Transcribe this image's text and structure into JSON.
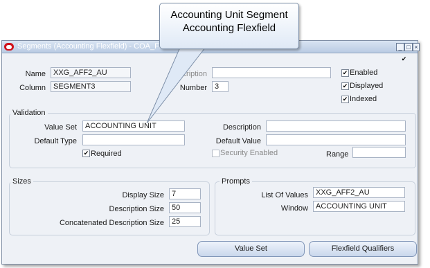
{
  "callout": {
    "line1": "Accounting Unit Segment",
    "line2": "Accounting Flexfield"
  },
  "window": {
    "title": "Segments (Accounting Flexfield) - COA_FLEXFIELD",
    "minimize": "_",
    "maximize": "□",
    "close": "×"
  },
  "top_checkmark": "✔",
  "segment": {
    "name_label": "Name",
    "name_value": "XXG_AFF2_AU",
    "column_label": "Column",
    "column_value": "SEGMENT3",
    "description_label": "Description",
    "description_value": "",
    "number_label": "Number",
    "number_value": "3",
    "enabled_label": "Enabled",
    "enabled_checked": true,
    "displayed_label": "Displayed",
    "displayed_checked": true,
    "indexed_label": "Indexed",
    "indexed_checked": true
  },
  "validation": {
    "title": "Validation",
    "value_set_label": "Value Set",
    "value_set_value": "ACCOUNTING UNIT",
    "default_type_label": "Default Type",
    "default_type_value": "",
    "required_label": "Required",
    "required_checked": true,
    "description_label": "Description",
    "description_value": "",
    "default_value_label": "Default Value",
    "default_value_value": "",
    "security_label": "Security Enabled",
    "security_checked": false,
    "range_label": "Range",
    "range_value": ""
  },
  "sizes": {
    "title": "Sizes",
    "display_label": "Display Size",
    "display_value": "7",
    "description_label": "Description Size",
    "description_value": "50",
    "concat_label": "Concatenated Description Size",
    "concat_value": "25"
  },
  "prompts": {
    "title": "Prompts",
    "list_label": "List Of Values",
    "list_value": "XXG_AFF2_AU",
    "window_label": "Window",
    "window_value": "ACCOUNTING UNIT"
  },
  "buttons": {
    "value_set": "Value Set",
    "qualifiers": "Flexfield Qualifiers"
  },
  "check_mark": "✔"
}
